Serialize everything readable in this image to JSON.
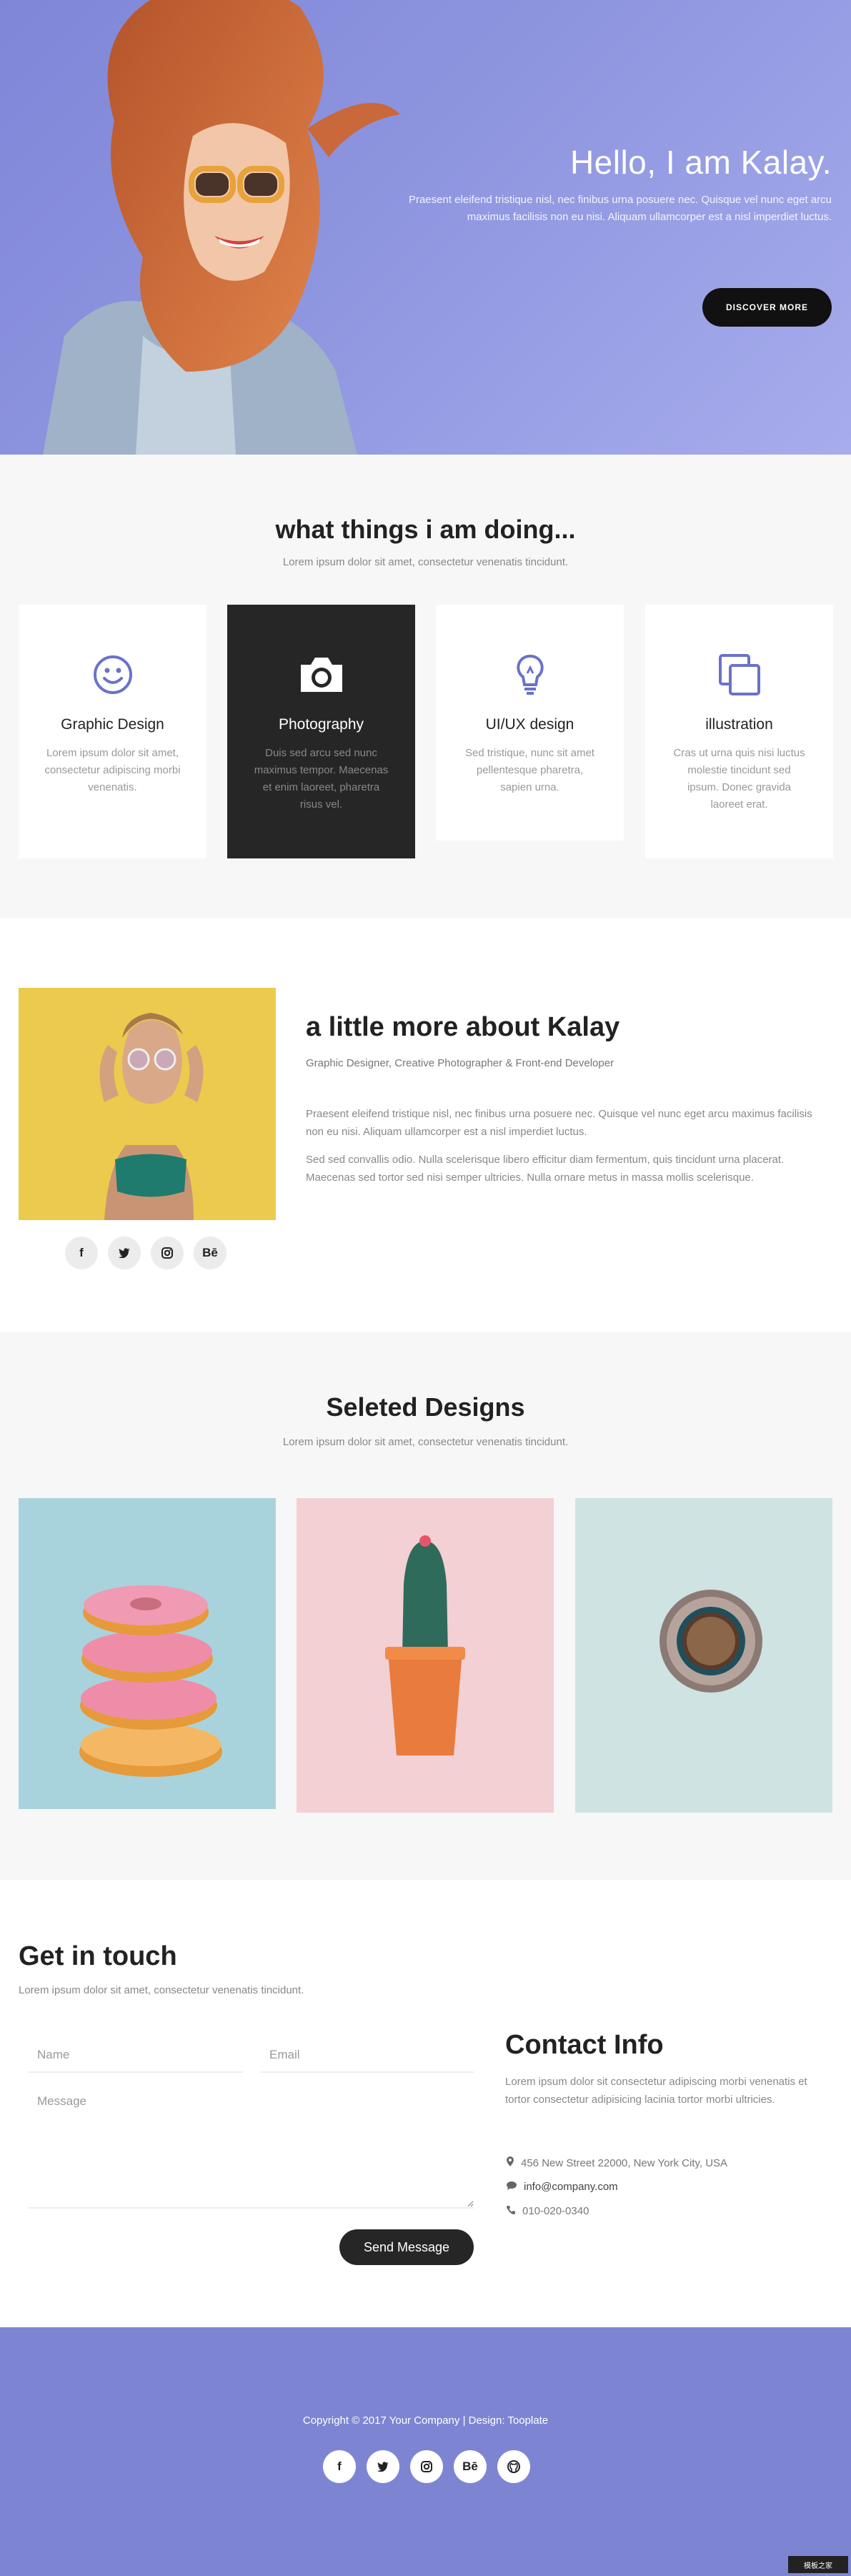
{
  "hero": {
    "title": "Hello, I am Kalay.",
    "subtitle": "Praesent eleifend tristique nisl, nec finibus urna posuere nec. Quisque vel nunc eget arcu maximus facilisis non eu nisi. Aliquam ullamcorper est a nisl imperdiet luctus.",
    "cta_label": "DISCOVER MORE",
    "bg_color": "#8e95df"
  },
  "doing": {
    "title": "what things i am doing...",
    "subtitle": "Lorem ipsum dolor sit amet, consectetur venenatis tincidunt.",
    "cards": [
      {
        "icon": "smile-icon",
        "title": "Graphic Design",
        "text": "Lorem ipsum dolor sit amet, consectetur adipiscing morbi venenatis."
      },
      {
        "icon": "camera-icon",
        "title": "Photography",
        "text": "Duis sed arcu sed nunc maximus tempor. Maecenas et enim laoreet, pharetra risus vel."
      },
      {
        "icon": "lightbulb-icon",
        "title": "UI/UX design",
        "text": "Sed tristique, nunc sit amet pellentesque pharetra, sapien urna."
      },
      {
        "icon": "copy-icon",
        "title": "illustration",
        "text": "Cras ut urna quis nisi luctus molestie tincidunt sed ipsum. Donec gravida laoreet erat."
      }
    ]
  },
  "about": {
    "title": "a little more about Kalay",
    "role": "Graphic Designer, Creative Photographer & Front-end Developer",
    "paragraph1": "Praesent eleifend tristique nisl, nec finibus urna posuere nec. Quisque vel nunc eget arcu maximus facilisis non eu nisi. Aliquam ullamcorper est a nisl imperdiet luctus.",
    "paragraph2": "Sed sed convallis odio. Nulla scelerisque libero efficitur diam fermentum, quis tincidunt urna placerat. Maecenas sed tortor sed nisi semper ultricies. Nulla ornare metus in massa mollis scelerisque.",
    "socials": [
      {
        "icon": "facebook-icon",
        "glyph": "f"
      },
      {
        "icon": "twitter-icon",
        "glyph": ""
      },
      {
        "icon": "instagram-icon",
        "glyph": ""
      },
      {
        "icon": "behance-icon",
        "glyph": "Bē"
      }
    ]
  },
  "designs": {
    "title": "Seleted Designs",
    "subtitle": "Lorem ipsum dolor sit amet, consectetur venenatis tincidunt.",
    "items": [
      {
        "name": "donuts-image",
        "bg": "#a9d3dc"
      },
      {
        "name": "cactus-image",
        "bg": "#f2d0d4"
      },
      {
        "name": "coffee-image",
        "bg": "#cfe3e2"
      }
    ]
  },
  "contact": {
    "title": "Get in touch",
    "subtitle": "Lorem ipsum dolor sit amet, consectetur venenatis tincidunt.",
    "name_placeholder": "Name",
    "email_placeholder": "Email",
    "message_placeholder": "Message",
    "send_label": "Send Message",
    "info_title": "Contact Info",
    "info_text": "Lorem ipsum dolor sit consectetur adipiscing morbi venenatis et tortor consectetur adipisicing lacinia tortor morbi ultricies.",
    "address": "456 New Street 22000, New York City, USA",
    "email": "info@company.com",
    "phone": "010-020-0340"
  },
  "footer": {
    "copyright": "Copyright © 2017 Your Company | Design: Tooplate",
    "bg_color": "#7d85d3",
    "watermark": "模板之家"
  }
}
